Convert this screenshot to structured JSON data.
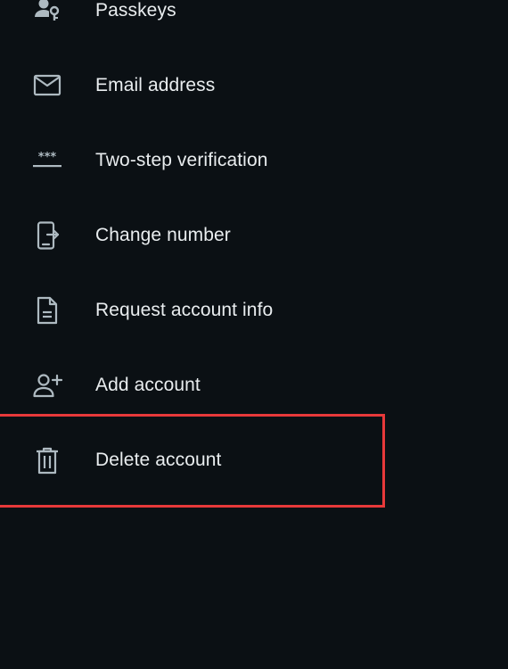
{
  "settings_list": {
    "items": [
      {
        "label": "Passkeys",
        "icon": "passkey-icon"
      },
      {
        "label": "Email address",
        "icon": "mail-icon"
      },
      {
        "label": "Two-step verification",
        "icon": "asterisks-icon"
      },
      {
        "label": "Change number",
        "icon": "phone-transfer-icon"
      },
      {
        "label": "Request account info",
        "icon": "document-icon"
      },
      {
        "label": "Add account",
        "icon": "add-person-icon"
      },
      {
        "label": "Delete account",
        "icon": "trash-icon"
      }
    ]
  },
  "highlight": {
    "color": "#e8393a",
    "target": "Delete account"
  },
  "colors": {
    "background": "#0b1014",
    "text": "#e9edef",
    "icon": "#aebac1"
  }
}
